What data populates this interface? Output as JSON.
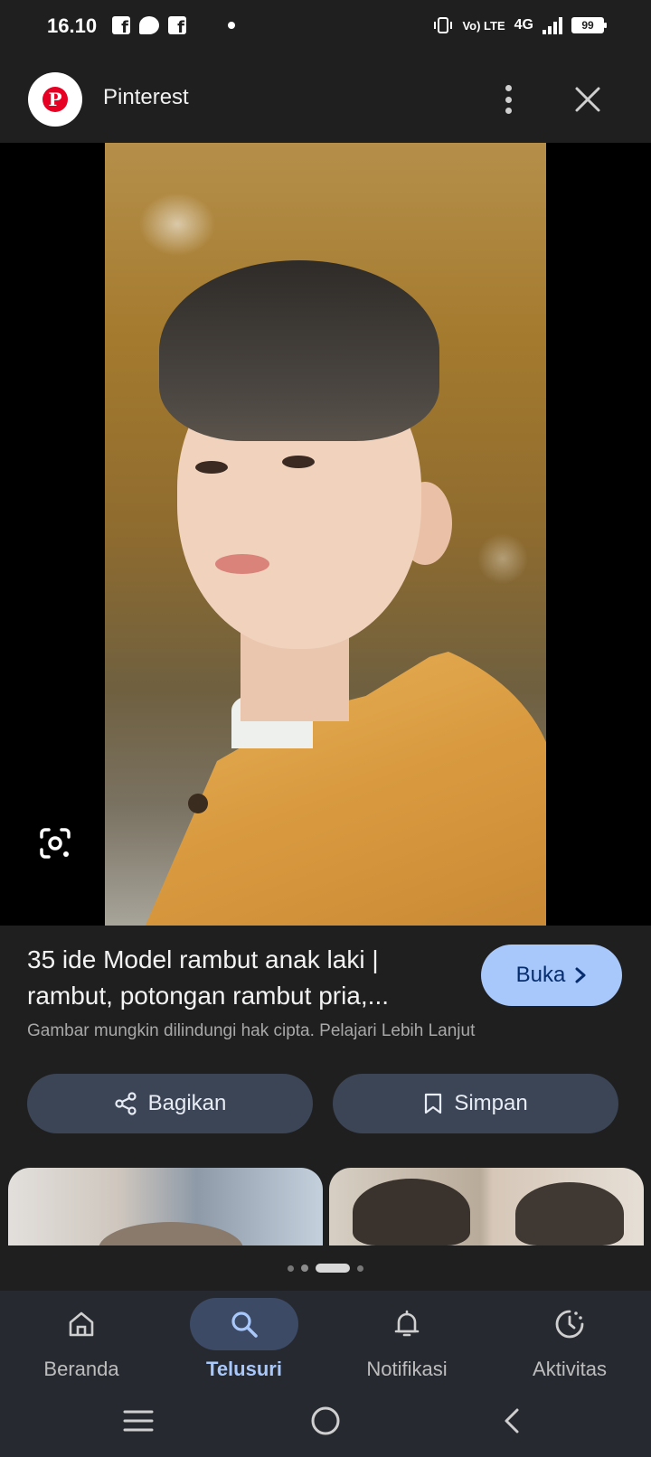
{
  "status_bar": {
    "time": "16.10",
    "lte_label": "Vo) LTE",
    "network": "4G",
    "battery": "99"
  },
  "header": {
    "app_name": "Pinterest",
    "logo_letter": "P",
    "icons": [
      "more-vertical-icon",
      "close-icon"
    ]
  },
  "image_viewer": {
    "lens_icon": "google-lens-icon"
  },
  "result": {
    "title": "35 ide Model rambut anak laki | rambut, potongan rambut pria,...",
    "open_label": "Buka",
    "copyright_note": "Gambar mungkin dilindungi hak cipta. Pelajari Lebih Lanjut",
    "share_label": "Bagikan",
    "save_label": "Simpan"
  },
  "pager": {
    "dots": 4,
    "active_index": 2
  },
  "bottom_nav": {
    "items": [
      {
        "label": "Beranda",
        "icon": "home-icon"
      },
      {
        "label": "Telusuri",
        "icon": "search-icon",
        "active": true
      },
      {
        "label": "Notifikasi",
        "icon": "bell-icon"
      },
      {
        "label": "Aktivitas",
        "icon": "activity-icon"
      }
    ]
  },
  "system_nav": {
    "icons": [
      "recents-icon",
      "home-circle-icon",
      "back-icon"
    ]
  },
  "colors": {
    "background": "#1f1f1f",
    "accent": "#a8c7fa",
    "button_bg": "#3b4556",
    "pinterest_red": "#e60023"
  }
}
